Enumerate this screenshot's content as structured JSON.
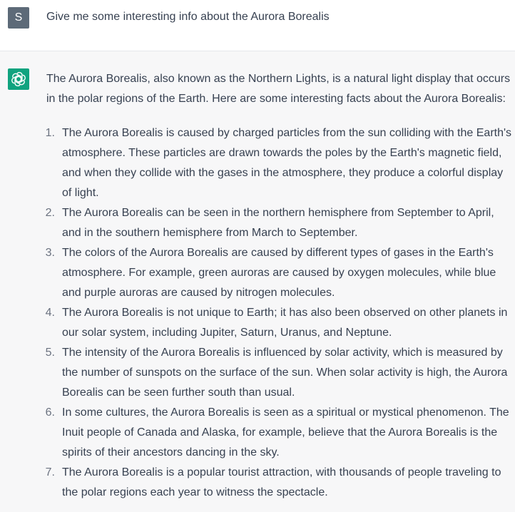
{
  "user_message": {
    "avatar_letter": "S",
    "text": "Give me some interesting info about the Aurora Borealis"
  },
  "assistant_message": {
    "avatar_icon": "openai-logo-icon",
    "intro": "The Aurora Borealis, also known as the Northern Lights, is a natural light display that occurs in the polar regions of the Earth. Here are some interesting facts about the Aurora Borealis:",
    "facts": [
      {
        "num": "1.",
        "text": "The Aurora Borealis is caused by charged particles from the sun colliding with the Earth's atmosphere. These particles are drawn towards the poles by the Earth's magnetic field, and when they collide with the gases in the atmosphere, they produce a colorful display of light."
      },
      {
        "num": "2.",
        "text": "The Aurora Borealis can be seen in the northern hemisphere from September to April, and in the southern hemisphere from March to September."
      },
      {
        "num": "3.",
        "text": "The colors of the Aurora Borealis are caused by different types of gases in the Earth's atmosphere. For example, green auroras are caused by oxygen molecules, while blue and purple auroras are caused by nitrogen molecules."
      },
      {
        "num": "4.",
        "text": "The Aurora Borealis is not unique to Earth; it has also been observed on other planets in our solar system, including Jupiter, Saturn, Uranus, and Neptune."
      },
      {
        "num": "5.",
        "text": "The intensity of the Aurora Borealis is influenced by solar activity, which is measured by the number of sunspots on the surface of the sun. When solar activity is high, the Aurora Borealis can be seen further south than usual."
      },
      {
        "num": "6.",
        "text": "In some cultures, the Aurora Borealis is seen as a spiritual or mystical phenomenon. The Inuit people of Canada and Alaska, for example, believe that the Aurora Borealis is the spirits of their ancestors dancing in the sky."
      },
      {
        "num": "7.",
        "text": "The Aurora Borealis is a popular tourist attraction, with thousands of people traveling to the polar regions each year to witness the spectacle."
      }
    ]
  },
  "colors": {
    "user_avatar_bg": "#5d6a78",
    "assistant_avatar_bg": "#10a37f",
    "assistant_row_bg": "#f7f7f8",
    "text": "#374151"
  }
}
